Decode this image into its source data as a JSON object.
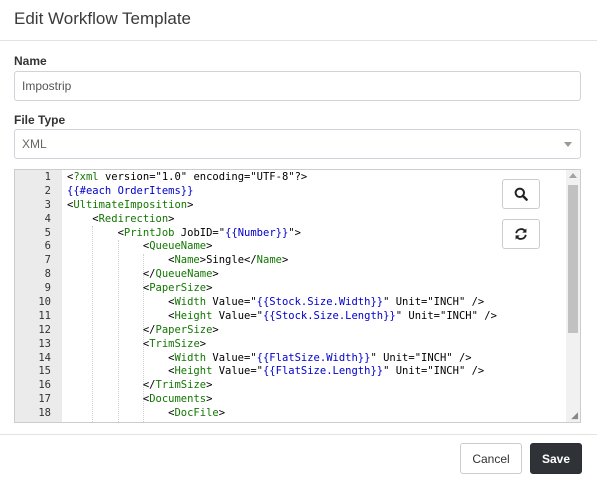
{
  "dialog": {
    "title": "Edit Workflow Template"
  },
  "form": {
    "name_label": "Name",
    "name_value": "Impostrip",
    "file_type_label": "File Type",
    "file_type_value": "XML"
  },
  "editor": {
    "line_numbers": [
      "1",
      "2",
      "3",
      "4",
      "5",
      "6",
      "7",
      "8",
      "9",
      "10",
      "11",
      "12",
      "13",
      "14",
      "15",
      "16",
      "17",
      "18"
    ],
    "lines": [
      "<?xml version=\"1.0\" encoding=\"UTF-8\"?>",
      "{{#each OrderItems}}",
      "<UltimateImposition>",
      "    <Redirection>",
      "        <PrintJob JobID=\"{{Number}}\">",
      "            <QueueName>",
      "                <Name>Single</Name>",
      "            </QueueName>",
      "            <PaperSize>",
      "                <Width Value=\"{{Stock.Size.Width}}\" Unit=\"INCH\" />",
      "                <Height Value=\"{{Stock.Size.Length}}\" Unit=\"INCH\" />",
      "            </PaperSize>",
      "            <TrimSize>",
      "                <Width Value=\"{{FlatSize.Width}}\" Unit=\"INCH\" />",
      "                <Height Value=\"{{FlatSize.Length}}\" Unit=\"INCH\" />",
      "            </TrimSize>",
      "            <Documents>",
      "                <DocFile>"
    ]
  },
  "tools": {
    "search_icon": "search-icon",
    "refresh_icon": "refresh-icon"
  },
  "footer": {
    "cancel_label": "Cancel",
    "save_label": "Save"
  },
  "colors": {
    "tag": "#117700",
    "handlebars": "#0000cc",
    "save_bg": "#2f3337"
  }
}
